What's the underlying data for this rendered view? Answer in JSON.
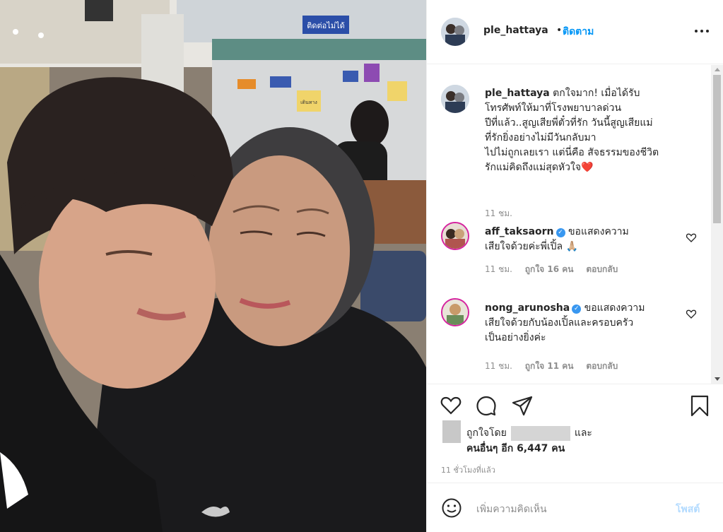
{
  "post": {
    "username": "ple_hattaya",
    "follow_label": "ติดตาม",
    "dot": "•"
  },
  "caption": {
    "username": "ple_hattaya",
    "text": "ตกใจมาก! เมื่อได้รับ\nโทรศัพท์ให้มาที่โรงพยาบาลด่วน\nปีที่แล้ว..สูญเสียพี่ตั๋วที่รัก วันนี้สูญเสียแม่\nที่รักยิ่งอย่างไม่มีวันกลับมา\nไปไม่ถูกเลยเรา แต่นี่คือ สัจธรรมของชีวิต\nรักแม่คิดถึงแม่สุดหัวใจ❤️",
    "time": "11 ชม."
  },
  "comments": [
    {
      "username": "aff_taksaorn",
      "text": "ขอแสดงความ\nเสียใจด้วยค่ะพี่เปิ้ล 🙏🏼",
      "time": "11 ชม.",
      "likes": "ถูกใจ 16 คน",
      "reply": "ตอบกลับ"
    },
    {
      "username": "nong_arunosha",
      "text": "ขอแสดงความ\nเสียใจด้วยกับน้องเปิ้ลและครอบครัว\nเป็นอย่างยิ่งค่ะ",
      "time": "11 ชม.",
      "likes": "ถูกใจ 11 คน",
      "reply": "ตอบกลับ"
    }
  ],
  "likes": {
    "prefix": "ถูกใจโดย",
    "and": "และ",
    "others": "คนอื่นๆ อีก 6,447 คน"
  },
  "posted_ago": "11 ชั่วโมงที่แล้ว",
  "add_comment": {
    "placeholder": "เพิ่มความคิดเห็น",
    "post_label": "โพสต์"
  },
  "photo": {
    "signs": [
      "ติดต่อไม่ได้",
      "เดินทาง"
    ]
  },
  "icons": {
    "heart": "heart-icon",
    "comment": "comment-icon",
    "share": "share-icon",
    "save": "bookmark-icon",
    "emoji": "emoji-icon",
    "more": "more-icon",
    "verified": "verified-icon"
  },
  "colors": {
    "link": "#0095f6",
    "verified": "#3897f0",
    "muted": "#8e8e8e",
    "post_disabled": "#b3dbff"
  }
}
